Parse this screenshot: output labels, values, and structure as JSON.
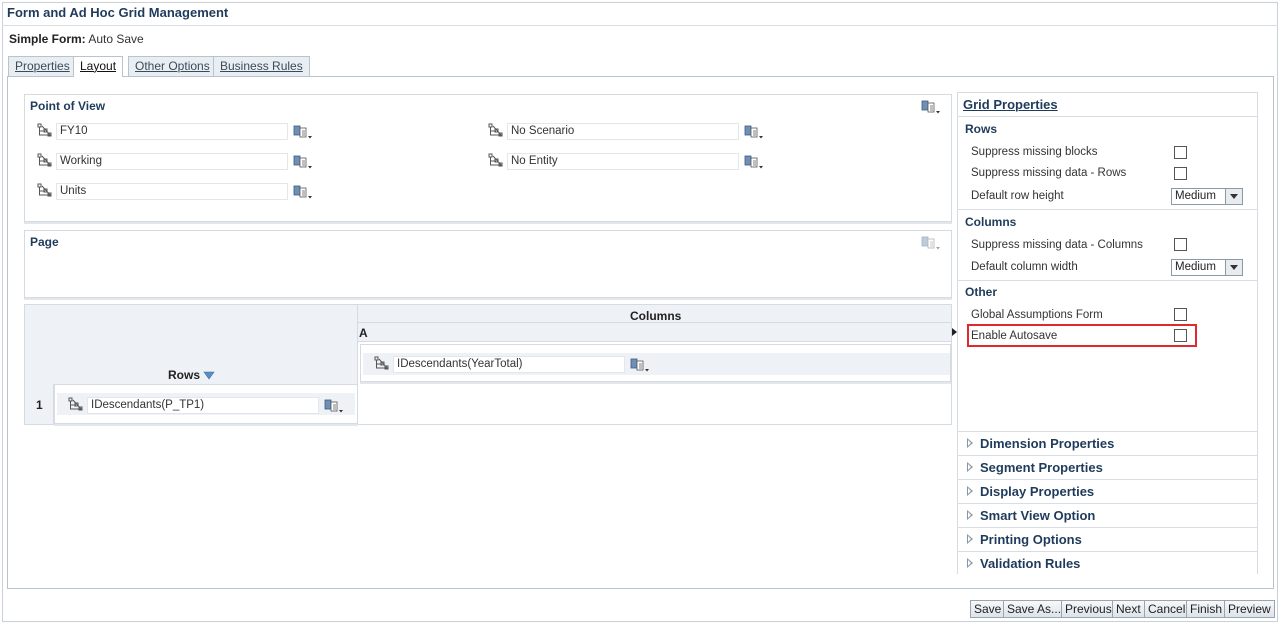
{
  "app": {
    "title": "Form and Ad Hoc Grid Management",
    "form_label": "Simple Form:",
    "form_name": "Auto Save"
  },
  "tabs": [
    {
      "label": "Properties",
      "active": false
    },
    {
      "label": "Layout",
      "active": true
    },
    {
      "label": "Other Options",
      "active": false
    },
    {
      "label": "Business Rules",
      "active": false
    }
  ],
  "pov": {
    "title": "Point of View",
    "members": [
      "FY10",
      "No Scenario",
      "Working",
      "No Entity",
      "Units"
    ]
  },
  "page": {
    "title": "Page"
  },
  "grid": {
    "rows_label": "Rows",
    "columns_label": "Columns",
    "column_letter": "A",
    "column_member": "IDescendants(YearTotal)",
    "row_number": "1",
    "row_member": "IDescendants(P_TP1)"
  },
  "grid_properties": {
    "title": "Grid Properties",
    "rows": {
      "title": "Rows",
      "suppress_missing_blocks": "Suppress missing blocks",
      "suppress_missing_rows": "Suppress missing data - Rows",
      "default_row_height": "Default row height",
      "row_height_value": "Medium"
    },
    "columns": {
      "title": "Columns",
      "suppress_missing_columns": "Suppress missing data - Columns",
      "default_column_width": "Default column width",
      "column_width_value": "Medium"
    },
    "other": {
      "title": "Other",
      "global_assumptions": "Global Assumptions Form",
      "enable_autosave": "Enable Autosave"
    },
    "highlight_color": "#e0282e"
  },
  "accordions": [
    "Dimension Properties",
    "Segment Properties",
    "Display Properties",
    "Smart View Option",
    "Printing Options",
    "Validation Rules"
  ],
  "buttons": [
    "Save",
    "Save As...",
    "Previous",
    "Next",
    "Cancel",
    "Finish",
    "Preview"
  ]
}
